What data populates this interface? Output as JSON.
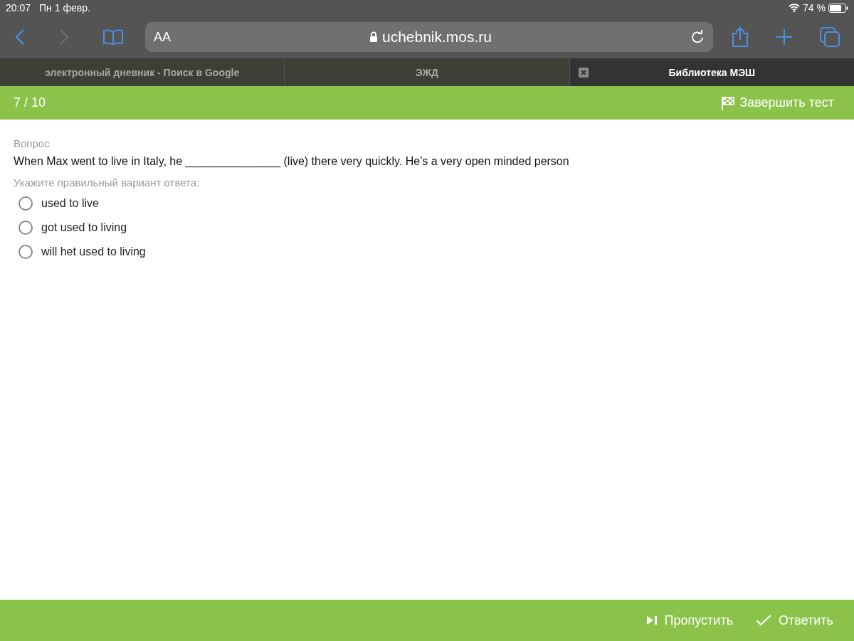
{
  "status_bar": {
    "time": "20:07",
    "date": "Пн 1 февр.",
    "battery": "74 %"
  },
  "browser": {
    "text_size": "AA",
    "url": "uchebnik.mos.ru"
  },
  "tabs": [
    {
      "label": "электронный дневник - Поиск в Google",
      "selected": false
    },
    {
      "label": "ЭЖД",
      "selected": false
    },
    {
      "label": "Библиотека МЭШ",
      "selected": true
    }
  ],
  "quiz_header": {
    "progress": "7 / 10",
    "finish_button": "Завершить тест"
  },
  "question": {
    "heading": "Вопрос",
    "text": "When Max went to live in Italy, he _______________ (live) there very quickly. He's a very open minded person",
    "instruction": "Укажите правильный вариант ответа:",
    "options": [
      {
        "label": "used to live",
        "selected": false
      },
      {
        "label": "got used to living",
        "selected": false
      },
      {
        "label": "will het used to living",
        "selected": false
      }
    ]
  },
  "footer": {
    "skip_button": "Пропустить",
    "answer_button": "Ответить"
  }
}
